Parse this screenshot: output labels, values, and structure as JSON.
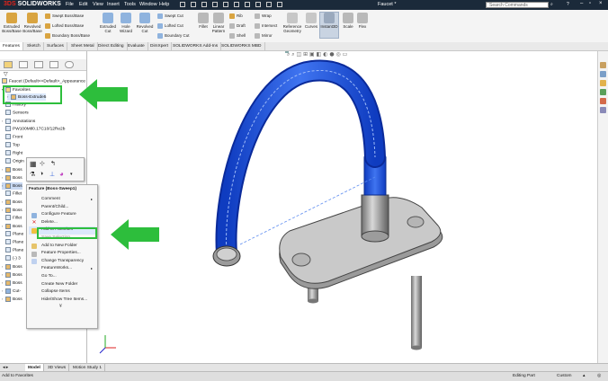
{
  "app": {
    "logo_prefix": "3DS",
    "logo_name": "SOLIDWORKS",
    "menus": [
      "File",
      "Edit",
      "View",
      "Insert",
      "Tools",
      "Window",
      "Help"
    ],
    "document_title": "Faucet *",
    "search_placeholder": "Search Commands"
  },
  "ribbon": {
    "big_buttons": [
      {
        "label": "Extruded Boss/Base"
      },
      {
        "label": "Revolved Boss/Base"
      },
      {
        "label": "Extruded Cut"
      },
      {
        "label": "Hole Wizard"
      },
      {
        "label": "Revolved Cut"
      },
      {
        "label": "Fillet"
      },
      {
        "label": "Linear Pattern"
      },
      {
        "label": "Reference Geometry"
      },
      {
        "label": "Curves"
      },
      {
        "label": "Instant3D"
      },
      {
        "label": "Scale"
      },
      {
        "label": "Flex"
      }
    ],
    "small_buttons": [
      "Swept Boss/Base",
      "Lofted Boss/Base",
      "Boundary Boss/Base",
      "Swept Cut",
      "Lofted Cut",
      "Boundary Cut",
      "Rib",
      "Draft",
      "Shell",
      "Wrap",
      "Intersect",
      "Mirror"
    ]
  },
  "command_tabs": [
    "Features",
    "Sketch",
    "Surfaces",
    "Sheet Metal",
    "Direct Editing",
    "Evaluate",
    "DimXpert",
    "SOLIDWORKS Add-Ins",
    "SOLIDWORKS MBD"
  ],
  "tree": {
    "root": "Faucet (Default<<Default>_Appearance",
    "rows": [
      {
        "label": "Favorites"
      },
      {
        "label": "Boss-Extrude5"
      },
      {
        "label": "History"
      },
      {
        "label": "Sensors"
      },
      {
        "label": "Annotations"
      },
      {
        "label": "PW100Mtl0.17C10/12Re2b"
      },
      {
        "label": "Front"
      },
      {
        "label": "Top"
      },
      {
        "label": "Right"
      },
      {
        "label": "Origin"
      },
      {
        "label": "Boss"
      },
      {
        "label": "Boss"
      },
      {
        "label": "Boss"
      },
      {
        "label": "Fillet"
      },
      {
        "label": "Boss"
      },
      {
        "label": "Boss"
      },
      {
        "label": "Fillet"
      },
      {
        "label": "Boss"
      },
      {
        "label": "Plane"
      },
      {
        "label": "Plane"
      },
      {
        "label": "Plane"
      },
      {
        "label": "(-) 3"
      },
      {
        "label": "Boss"
      },
      {
        "label": "Boss"
      },
      {
        "label": "Boss"
      },
      {
        "label": "Cut-"
      },
      {
        "label": "Boss"
      }
    ]
  },
  "context_menu": {
    "header": "Feature (Boss-Sweep1)",
    "items": [
      {
        "label": "Comment",
        "submenu": true
      },
      {
        "label": "Parent/Child...",
        "submenu": false
      },
      {
        "label": "Configure Feature",
        "submenu": false
      },
      {
        "label": "Delete...",
        "submenu": false
      },
      {
        "label": "Add to Favorites",
        "submenu": false
      },
      {
        "label": "Save Selection",
        "submenu": false
      },
      {
        "label": "Add to New Folder",
        "submenu": false
      },
      {
        "label": "Feature Properties...",
        "submenu": false
      },
      {
        "label": "Change Transparency",
        "submenu": false
      },
      {
        "label": "FeatureWorks...",
        "submenu": true
      },
      {
        "label": "Go To...",
        "submenu": false
      },
      {
        "label": "Create New Folder",
        "submenu": false
      },
      {
        "label": "Collapse Items",
        "submenu": false
      },
      {
        "label": "Hide/Show Tree Items...",
        "submenu": false
      }
    ],
    "more_glyph": "¥"
  },
  "bottom_tabs": [
    "Model",
    "3D Views",
    "Motion Study 1"
  ],
  "status": {
    "left": "Add to Favorites",
    "mode": "Editing Part",
    "units": "Custom"
  },
  "colors": {
    "highlight_green": "#2dbe3c",
    "selection_blue": "#1d4fd0",
    "title_bar": "#1b2a3a"
  }
}
